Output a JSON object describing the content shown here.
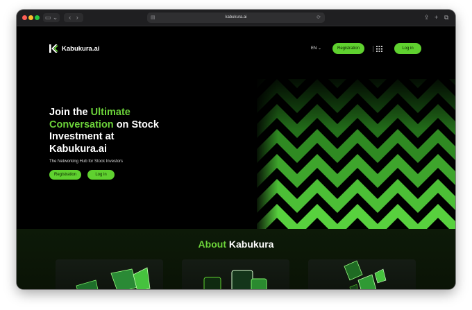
{
  "browser": {
    "url": "kabukura.ai",
    "sidebar_icon": "sidebar-icon",
    "back_icon": "chevron-left-icon",
    "forward_icon": "chevron-right-icon",
    "share_icon": "share-icon",
    "new_tab_icon": "plus-icon",
    "tabs_icon": "tabs-overview-icon"
  },
  "header": {
    "brand": "Kabukura.ai",
    "language": "EN",
    "registration": "Registration",
    "login": "Log in"
  },
  "hero": {
    "title_line1_a": "Join the ",
    "title_line1_b": "Ultimate",
    "title_line2_a": "Conversation",
    "title_line2_b": " on Stock",
    "title_line3": "Investment at",
    "title_line4": "Kabukura.ai",
    "subtitle": "The Networking Hub for Stock Investors",
    "registration": "Registration",
    "login": "Log in"
  },
  "about": {
    "title_a": "About",
    "title_b": " Kabukura"
  },
  "colors": {
    "accent": "#5fd12f",
    "background": "#000000"
  }
}
